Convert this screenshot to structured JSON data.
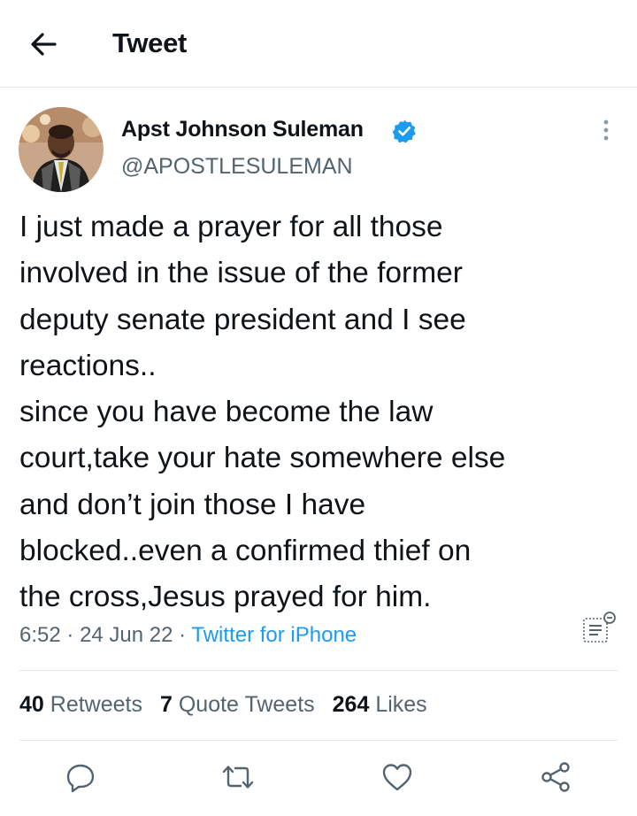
{
  "header": {
    "title": "Tweet",
    "back_icon": "arrow-left-icon"
  },
  "author": {
    "name": "Apst Johnson Suleman",
    "handle": "@APOSTLESULEMAN",
    "verified": true,
    "verified_color": "#1d9bf0"
  },
  "tweet": {
    "lines": [
      "I just made a prayer for all those",
      "involved in the issue of the former",
      "deputy senate president and I see",
      "reactions..",
      "since you have become the law",
      "court,take your hate somewhere else",
      "and don’t join those I have",
      "blocked..even a confirmed thief on",
      "the cross,Jesus prayed for him."
    ]
  },
  "meta": {
    "time": "6:52",
    "date": "24 Jun 22",
    "separator": "·",
    "source": "Twitter for iPhone"
  },
  "stats": {
    "retweets_count": "40",
    "retweets_label": "Retweets",
    "quotes_count": "7",
    "quotes_label": "Quote Tweets",
    "likes_count": "264",
    "likes_label": "Likes"
  },
  "actions": [
    "reply-icon",
    "retweet-icon",
    "like-icon",
    "share-icon"
  ],
  "colors": {
    "accent": "#1d9bf0",
    "text": "#0f1419",
    "secondary": "#536471",
    "divider": "#e6e6e6"
  }
}
